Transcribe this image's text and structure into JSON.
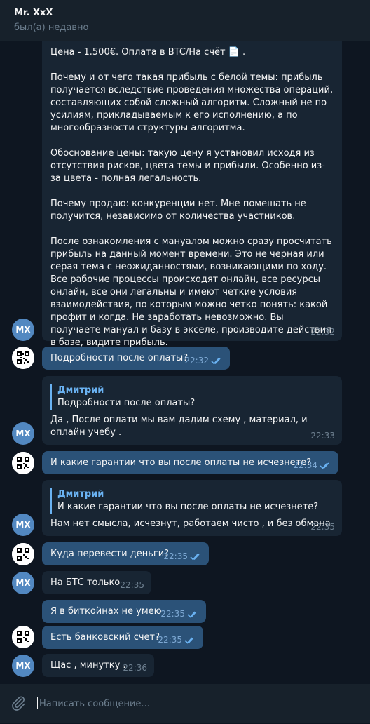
{
  "header": {
    "name": "Mr. XxX",
    "status": "был(а) недавно"
  },
  "avatar_initials": "MX",
  "messages": [
    {
      "id": 0,
      "direction": "in",
      "text": "Цена - 1.500€. Оплата в BTC/На счёт 📄 .\n\nПочему и от чего такая прибыль с белой темы: прибыль получается вследствие проведения множества операций, составляющих собой сложный алгоритм. Сложный не по усилиям, прикладываемым к его исполнению, а по многообразности структуры алгоритма.\n\nОбоснование цены: такую цену я установил исходя из отсутствия рисков, цвета темы и прибыли. Особенно из-за цвета - полная легальность.\n\nПочему продаю: конкуренции нет. Мне помешать не получится, независимо от количества участников.\n\nПосле ознакомления с мануалом можно сразу просчитать прибыль на данный момент времени. Это не черная или серая тема с неожиданностями, возникающими по ходу. Все рабочие процессы происходят онлайн, все ресурсы онлайн, все они легальны и имеют четкие условия взаимодействия, по которым можно четко понять: какой профит и когда. Не заработать невозможно. Вы получаете мануал и базу в экселе, производите действия в базе, видите прибыль.",
      "time": "22:32"
    },
    {
      "id": 1,
      "direction": "out",
      "text": "Подробности после оплаты?",
      "time": "22:32"
    },
    {
      "id": 2,
      "direction": "in",
      "reply_author": "Дмитрий",
      "reply_text": "Подробности после оплаты?",
      "text": "Да , После оплати мы вам дадим схему , материал, и оплайн учебу .",
      "time": "22:33"
    },
    {
      "id": 3,
      "direction": "out",
      "text": "И какие гарантии что вы после оплаты не исчезнете?",
      "time": "22:34"
    },
    {
      "id": 4,
      "direction": "in",
      "reply_author": "Дмитрий",
      "reply_text": "И какие гарантии что вы после оплаты не исчезнете?",
      "text": "Нам нет смысла, исчезнут, работаем чисто , и без обмана",
      "time": "22:35"
    },
    {
      "id": 5,
      "direction": "out",
      "text": "Куда перевести деньги?",
      "time": "22:35"
    },
    {
      "id": 6,
      "direction": "in",
      "text": "На БТС только",
      "time": "22:35"
    },
    {
      "id": 7,
      "direction": "out",
      "text": "Я в биткойнах не умею",
      "time": "22:35"
    },
    {
      "id": 8,
      "direction": "out",
      "text": "Есть банковский счет?",
      "time": "22:35"
    },
    {
      "id": 9,
      "direction": "in",
      "text": "Щас , минутку .",
      "time": "22:36"
    }
  ],
  "composer": {
    "placeholder": "Написать сообщение..."
  },
  "colors": {
    "background": "#0e1621",
    "incoming": "#182533",
    "outgoing": "#2b5278",
    "accent": "#6ab2f2"
  },
  "icons": {
    "attach": "paperclip-icon",
    "read": "double-check-icon"
  }
}
